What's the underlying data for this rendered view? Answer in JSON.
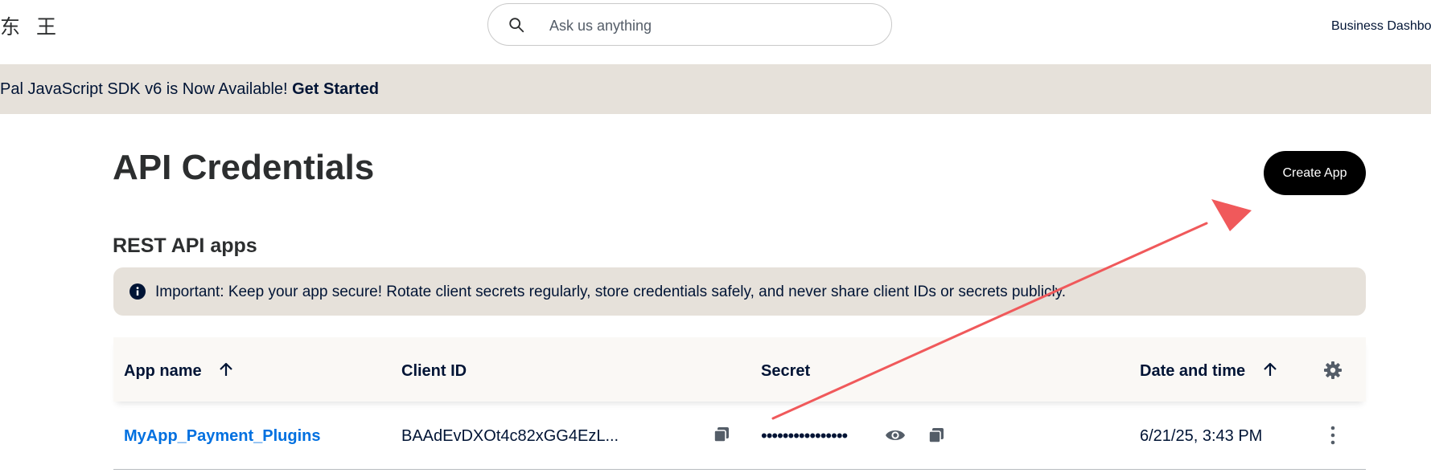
{
  "header": {
    "logo_text": "东 王",
    "search": {
      "placeholder": "Ask us anything",
      "value": ""
    },
    "business_link": "Business Dashbo"
  },
  "banner": {
    "text": "Pal JavaScript SDK v6 is Now Available! ",
    "link": "Get Started"
  },
  "page": {
    "title": "API Credentials",
    "create_button": "Create App",
    "section_title": "REST API apps"
  },
  "notice": {
    "text": "Important: Keep your app secure! Rotate client secrets regularly, store credentials safely, and never share client IDs or secrets publicly."
  },
  "table": {
    "columns": [
      "App name",
      "Client ID",
      "Secret",
      "Date and time"
    ],
    "rows": [
      {
        "app_name": "MyApp_Payment_Plugins",
        "client_id": "BAAdEvDXOt4c82xGG4EzL...",
        "secret": "••••••••••••••••",
        "date": "6/21/25, 3:43 PM"
      }
    ]
  },
  "icons": {
    "search": "search-icon",
    "info": "info-icon",
    "sort": "arrow-up-icon",
    "settings": "gear-icon",
    "copy": "copy-icon",
    "reveal": "eye-icon",
    "more": "kebab-icon"
  },
  "colors": {
    "banner_bg": "#e6e1da",
    "link_blue": "#0070e0",
    "text_navy": "#001435",
    "annotation_arrow": "#f0595b"
  }
}
